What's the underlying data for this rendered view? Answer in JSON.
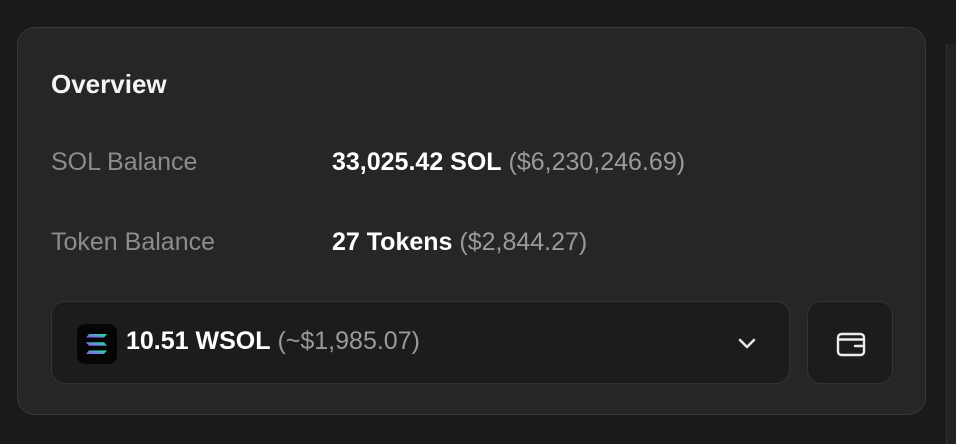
{
  "overview": {
    "title": "Overview",
    "sol_balance": {
      "label": "SOL Balance",
      "amount": "33,025.42 SOL",
      "usd": "($6,230,246.69)"
    },
    "token_balance": {
      "label": "Token Balance",
      "amount": "27 Tokens",
      "usd": "($2,844.27)"
    },
    "token_select": {
      "icon": "solana-logo-icon",
      "amount": "10.51 WSOL",
      "usd": "(~$1,985.07)",
      "chevron_icon": "chevron-down-icon"
    },
    "wallet_button": {
      "icon": "wallet-icon"
    }
  },
  "colors": {
    "page_bg": "#1a1a1a",
    "card_bg": "#262626",
    "select_bg": "#1c1c1c",
    "text_primary": "#ffffff",
    "text_muted": "#8c8c8c",
    "solana_gradient": [
      "#9945ff",
      "#14f195"
    ]
  }
}
